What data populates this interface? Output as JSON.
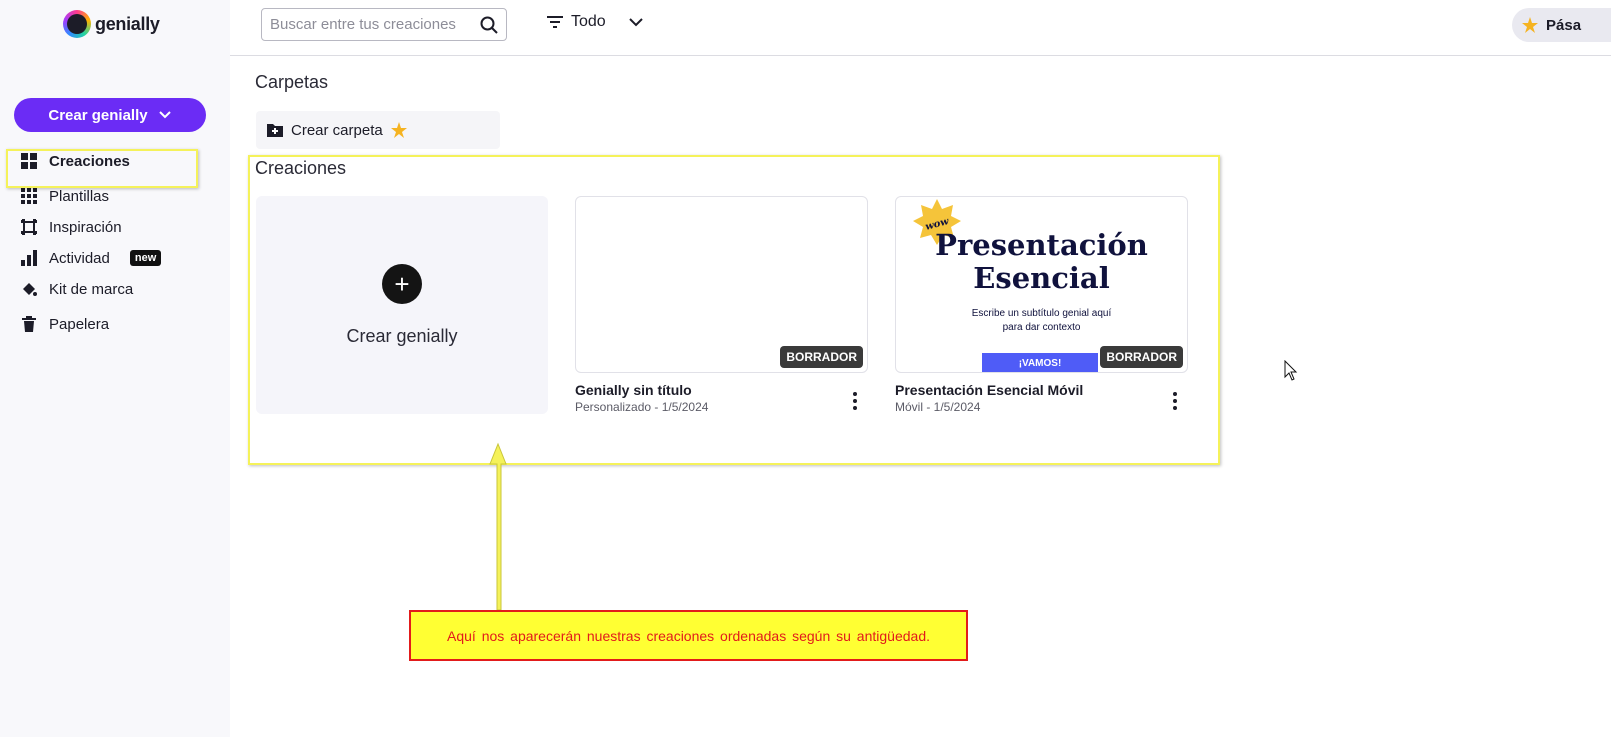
{
  "brand": {
    "name": "genially"
  },
  "sidebar": {
    "create_label": "Crear genially",
    "items": [
      {
        "label": "Creaciones",
        "icon": "grid-icon"
      },
      {
        "label": "Plantillas",
        "icon": "apps-grid-icon"
      },
      {
        "label": "Inspiración",
        "icon": "frame-icon"
      },
      {
        "label": "Actividad",
        "icon": "bar-chart-icon",
        "badge": "new"
      },
      {
        "label": "Kit de marca",
        "icon": "paint-bucket-icon"
      },
      {
        "label": "Papelera",
        "icon": "trash-icon"
      }
    ]
  },
  "topbar": {
    "search_placeholder": "Buscar entre tus creaciones",
    "filter_label": "Todo",
    "upgrade_label": "Pása"
  },
  "main": {
    "folders_title": "Carpetas",
    "create_folder_label": "Crear carpeta",
    "creations_title": "Creaciones",
    "new_card_label": "Crear genially",
    "cards": [
      {
        "title": "Genially sin título",
        "meta": "Personalizado - 1/5/2024",
        "tag": "BORRADOR"
      },
      {
        "title": "Presentación Esencial Móvil",
        "meta": "Móvil - 1/5/2024",
        "tag": "BORRADOR",
        "preview_title_1": "Presentación",
        "preview_title_2": "Esencial",
        "preview_sub_1": "Escribe un subtítulo genial aquí",
        "preview_sub_2": "para dar contexto",
        "preview_button": "¡VAMOS!",
        "preview_sticker": "wow"
      }
    ]
  },
  "annotation": {
    "callout_text": "Aquí nos aparecerán nuestras creaciones ordenadas según su antigüedad."
  },
  "colors": {
    "accent": "#6b2cf5",
    "highlight": "#f5f25a",
    "callout_bg": "#ffff33",
    "callout_text": "#e21b1b"
  }
}
